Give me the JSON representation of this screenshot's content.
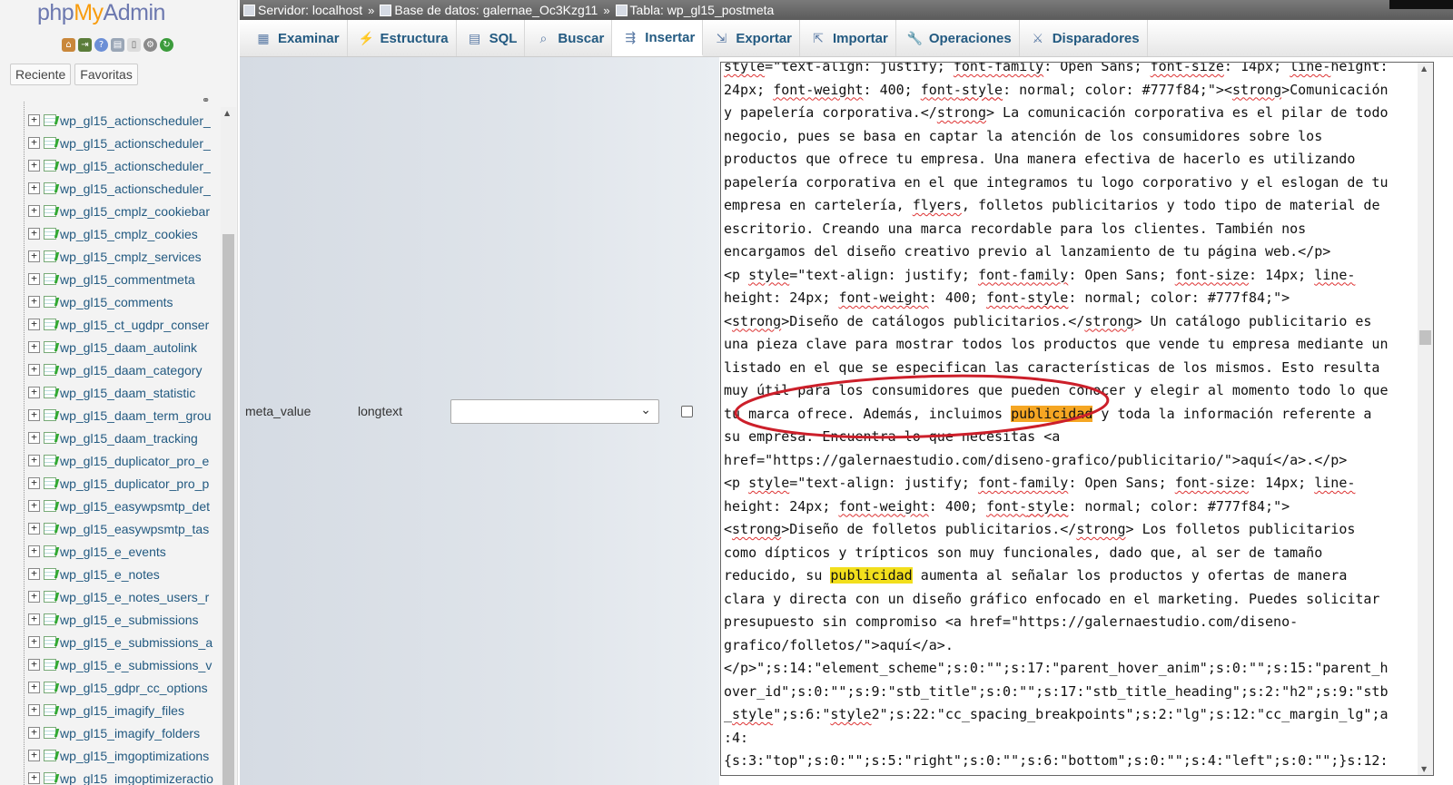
{
  "sidebar": {
    "logo_php": "php",
    "logo_my": "My",
    "logo_admin": "Admin",
    "recent_label": "Reciente",
    "favorites_label": "Favoritas",
    "tables": [
      "wp_gl15_actionscheduler_",
      "wp_gl15_actionscheduler_",
      "wp_gl15_actionscheduler_",
      "wp_gl15_actionscheduler_",
      "wp_gl15_cmplz_cookiebar",
      "wp_gl15_cmplz_cookies",
      "wp_gl15_cmplz_services",
      "wp_gl15_commentmeta",
      "wp_gl15_comments",
      "wp_gl15_ct_ugdpr_conser",
      "wp_gl15_daam_autolink",
      "wp_gl15_daam_category",
      "wp_gl15_daam_statistic",
      "wp_gl15_daam_term_grou",
      "wp_gl15_daam_tracking",
      "wp_gl15_duplicator_pro_e",
      "wp_gl15_duplicator_pro_p",
      "wp_gl15_easywpsmtp_det",
      "wp_gl15_easywpsmtp_tas",
      "wp_gl15_e_events",
      "wp_gl15_e_notes",
      "wp_gl15_e_notes_users_r",
      "wp_gl15_e_submissions",
      "wp_gl15_e_submissions_a",
      "wp_gl15_e_submissions_v",
      "wp_gl15_gdpr_cc_options",
      "wp_gl15_imagify_files",
      "wp_gl15_imagify_folders",
      "wp_gl15_imgoptimizations",
      "wp_gl15_imgoptimizeractio"
    ]
  },
  "breadcrumb": {
    "server": "Servidor: localhost",
    "database": "Base de datos: galernae_Oc3Kzg11",
    "table": "Tabla: wp_gl15_postmeta",
    "separator": "»"
  },
  "tabs": [
    {
      "label": "Examinar",
      "icon": "table-browse-icon"
    },
    {
      "label": "Estructura",
      "icon": "structure-icon"
    },
    {
      "label": "SQL",
      "icon": "sql-icon"
    },
    {
      "label": "Buscar",
      "icon": "search-icon"
    },
    {
      "label": "Insertar",
      "icon": "insert-icon"
    },
    {
      "label": "Exportar",
      "icon": "export-icon"
    },
    {
      "label": "Importar",
      "icon": "import-icon"
    },
    {
      "label": "Operaciones",
      "icon": "wrench-icon"
    },
    {
      "label": "Disparadores",
      "icon": "triggers-icon"
    }
  ],
  "active_tab": "Insertar",
  "field": {
    "name": "meta_value",
    "type": "longtext",
    "function_value": ""
  },
  "value_text_lines": [
    "style=\"text-align: justify; font-family: Open Sans; font-size: 14px; line-height:",
    "24px; font-weight: 400; font-style: normal; color: #777f84;\"><strong>Comunicación",
    "y papelería corporativa.</strong> La comunicación corporativa es el pilar de todo",
    "negocio, pues se basa en captar la atención de los consumidores sobre los",
    "productos que ofrece tu empresa. Una manera efectiva de hacerlo es utilizando",
    "papelería corporativa en el que integramos tu logo corporativo y el eslogan de tu",
    "empresa en cartelería, flyers, folletos publicitarios y todo tipo de material de",
    "escritorio. Creando una marca recordable para los clientes. También nos",
    "encargamos del diseño creativo previo al lanzamiento de tu página web.</p>",
    "<p style=\"text-align: justify; font-family: Open Sans; font-size: 14px; line-",
    "height: 24px; font-weight: 400; font-style: normal; color: #777f84;\">",
    "<strong>Diseño de catálogos publicitarios.</strong> Un catálogo publicitario es",
    "una pieza clave para mostrar todos los productos que vende tu empresa mediante un",
    "listado en el que se especifican las características de los mismos. Esto resulta",
    "muy útil para los consumidores que pueden conocer y elegir al momento todo lo que",
    "tu marca ofrece. Además, incluimos publicidad y toda la información referente a",
    "su empresa. Encuentra lo que necesitas <a",
    "href=\"https://galernaestudio.com/diseno-grafico/publicitario/\">aquí</a>.</p>",
    "<p style=\"text-align: justify; font-family: Open Sans; font-size: 14px; line-",
    "height: 24px; font-weight: 400; font-style: normal; color: #777f84;\">",
    "<strong>Diseño de folletos publicitarios.</strong> Los folletos publicitarios",
    "como dípticos y trípticos son muy funcionales, dado que, al ser de tamaño",
    "reducido, su publicidad aumenta al señalar los productos y ofertas de manera",
    "clara y directa con un diseño gráfico enfocado en el marketing. Puedes solicitar",
    "presupuesto sin compromiso <a href=\"https://galernaestudio.com/diseno-",
    "grafico/folletos/\">aquí</a>.",
    "</p>\";s:14:\"element_scheme\";s:0:\"\";s:17:\"parent_hover_anim\";s:0:\"\";s:15:\"parent_h",
    "over_id\";s:0:\"\";s:9:\"stb_title\";s:0:\"\";s:17:\"stb_title_heading\";s:2:\"h2\";s:9:\"stb",
    "_style\";s:6:\"style2\";s:22:\"cc_spacing_breakpoints\";s:2:\"lg\";s:12:\"cc_margin_lg\";a",
    ":4:",
    "{s:3:\"top\";s:0:\"\";s:5:\"right\";s:0:\"\";s:6:\"bottom\";s:0:\"\";s:4:\"left\";s:0:\"\";}s:12:"
  ],
  "highlight_word": "publicidad",
  "colors": {
    "breadcrumb_bg": "#666666",
    "link_blue": "#235a81",
    "highlight_yellow": "#f2df1c",
    "highlight_orange": "#f5a623",
    "annotation_red": "#cc1f2a"
  }
}
